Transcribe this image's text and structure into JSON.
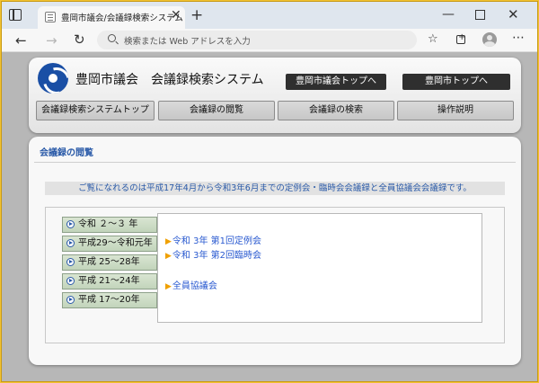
{
  "browser": {
    "tab_title": "豊岡市議会/会議録検索システム",
    "tab_close": "✕",
    "new_tab": "+",
    "address_placeholder": "検索または Web アドレスを入力",
    "back": "←",
    "forward": "→",
    "reload": "↻",
    "favorites": "☆",
    "more": "⋯",
    "minimize": "—",
    "close": "✕"
  },
  "header": {
    "site_title": "豊岡市議会　会議録検索システム",
    "buttons": [
      "豊岡市議会トップへ",
      "豊岡市トップへ"
    ]
  },
  "nav": {
    "items": [
      "会議録検索システムトップ",
      "会議録の閲覧",
      "会議録の検索",
      "操作説明"
    ]
  },
  "content": {
    "section_title": "会議録の閲覧",
    "notice": "ご覧になれるのは平成17年4月から令和3年6月までの定例会・臨時会会議録と全員協議会会議録です。",
    "eras": [
      "令和 ２～３ 年",
      "平成29～令和元年",
      "平成 25～28年",
      "平成 21～24年",
      "平成 17～20年"
    ],
    "links": [
      "令和 3年 第1回定例会",
      "令和 3年 第2回臨時会",
      "全員協議会"
    ],
    "link_arrow": "▶"
  },
  "colors": {
    "frame": "#f2c230",
    "link": "#2a5ad0",
    "heading": "#2a5aa8",
    "dark_button": "#2f2f2f",
    "era_bg": "#cfdcc8"
  }
}
